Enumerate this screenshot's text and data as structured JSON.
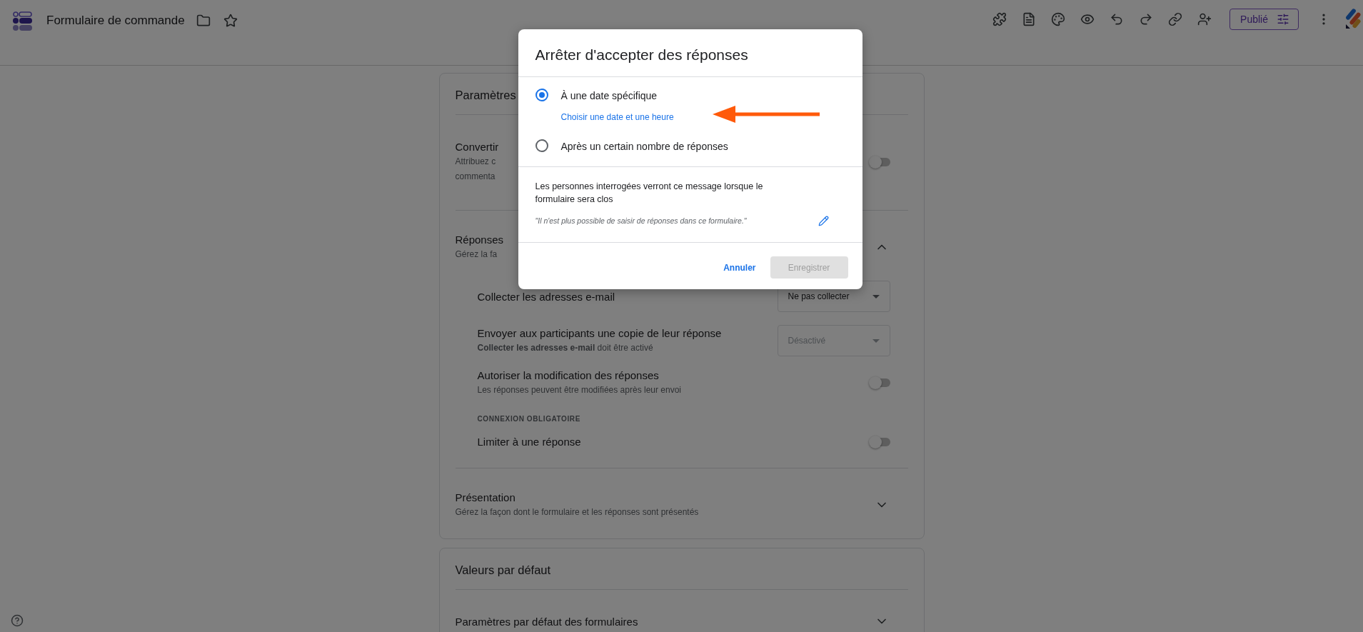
{
  "header": {
    "title": "Formulaire de commande",
    "publish_button": "Publié"
  },
  "settings_card": {
    "title": "Paramètres",
    "sections": [
      {
        "kind": "toggle",
        "title": "Convertir",
        "subtitle_lines": [
          "Attribuez c",
          "commenta"
        ],
        "on": false
      },
      {
        "kind": "group",
        "title": "Réponses",
        "subtitle": "Gérez la fa",
        "expanded": true,
        "items": [
          {
            "kind": "select",
            "label": "Collecter les adresses e-mail",
            "value": "Ne pas collecter",
            "disabled": false
          },
          {
            "kind": "select",
            "label": "Envoyer aux participants une copie de leur réponse",
            "note": "**Collecter les adresses e-mail** doit être activé",
            "value": "Désactivé",
            "disabled": true
          },
          {
            "kind": "toggle",
            "label": "Autoriser la modification des réponses",
            "note": "Les réponses peuvent être modifiées après leur envoi",
            "on": false
          },
          {
            "kind": "heading",
            "label": "CONNEXION OBLIGATOIRE"
          },
          {
            "kind": "toggle",
            "label": "Limiter à une réponse",
            "on": false
          }
        ]
      },
      {
        "kind": "group",
        "title": "Présentation",
        "subtitle": "Gérez la façon dont le formulaire et les réponses sont présentés",
        "expanded": false
      }
    ]
  },
  "defaults_card": {
    "title": "Valeurs par défaut",
    "sections": [
      {
        "kind": "group",
        "title": "Paramètres par défaut des formulaires",
        "expanded": false
      }
    ]
  },
  "dialog": {
    "title": "Arrêter d'accepter des réponses",
    "options": [
      {
        "label": "À une date spécifique",
        "selected": true,
        "link": "Choisir une date et une heure"
      },
      {
        "label": "Après un certain nombre de réponses",
        "selected": false
      }
    ],
    "message": "Les personnes interrogées verront ce message lorsque le formulaire sera clos",
    "quote": "\"Il n'est plus possible de saisir de réponses dans ce formulaire.\"",
    "cancel_button": "Annuler",
    "save_button": {
      "label": "Enregistrer",
      "disabled": true
    }
  }
}
